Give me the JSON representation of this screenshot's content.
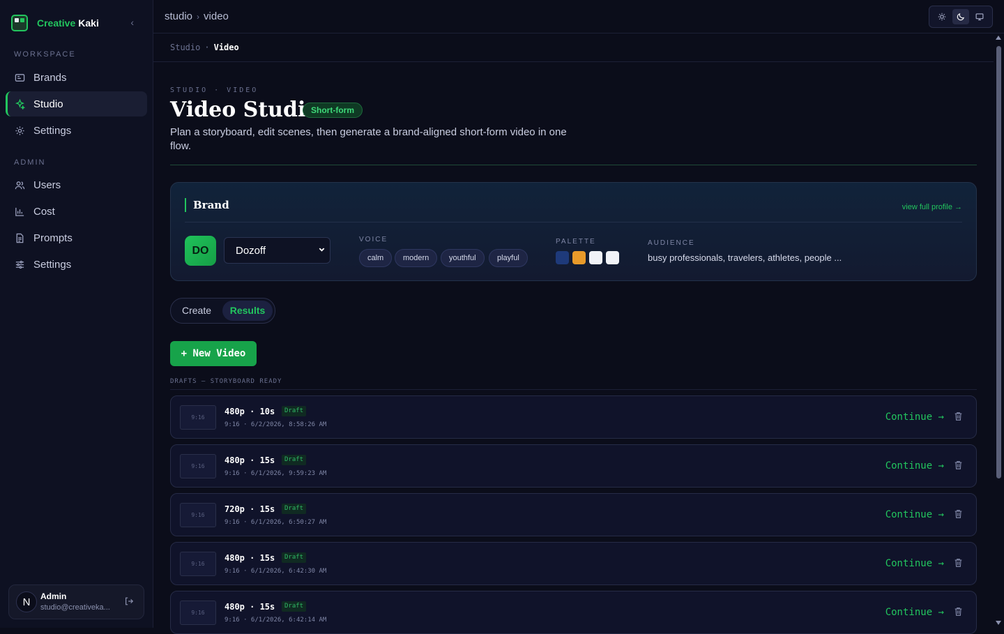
{
  "app": {
    "name_part1": "Creative",
    "name_part2": "Kaki"
  },
  "sidebar": {
    "workspace_label": "WORKSPACE",
    "workspace_items": [
      {
        "label": "Brands",
        "icon": "brands-icon"
      },
      {
        "label": "Studio",
        "icon": "sparkles-icon"
      },
      {
        "label": "Settings",
        "icon": "gear-icon"
      }
    ],
    "admin_label": "ADMIN",
    "admin_items": [
      {
        "label": "Users",
        "icon": "users-icon"
      },
      {
        "label": "Cost",
        "icon": "chart-icon"
      },
      {
        "label": "Prompts",
        "icon": "document-icon"
      },
      {
        "label": "Settings",
        "icon": "sliders-icon"
      }
    ],
    "active_item": "Studio"
  },
  "user": {
    "initial": "N",
    "name": "Admin",
    "email": "studio@creativeka..."
  },
  "topbar": {
    "crumb1": "studio",
    "crumb2": "video"
  },
  "subcrumbs": {
    "parent": "Studio",
    "current": "Video"
  },
  "page": {
    "eyebrow": "STUDIO · VIDEO",
    "title": "Video Studio",
    "badge": "Short-form",
    "subtitle": "Plan a storyboard, edit scenes, then generate a brand-aligned short-form video in one flow."
  },
  "brand": {
    "heading": "Brand",
    "view_profile": "view full profile →",
    "initials": "DO",
    "selected": "Dozoff",
    "voice_label": "VOICE",
    "voice": [
      "calm",
      "modern",
      "youthful",
      "playful"
    ],
    "palette_label": "PALETTE",
    "palette": [
      "#1e3a7a",
      "#e89a2a",
      "#f1f3f8",
      "#f1f3f8"
    ],
    "audience_label": "AUDIENCE",
    "audience": "busy professionals, travelers, athletes, people ..."
  },
  "tabs": {
    "create": "Create",
    "results": "Results",
    "active": "Results"
  },
  "actions": {
    "new_video": "+ New Video"
  },
  "drafts": {
    "label": "DRAFTS — STORYBOARD READY",
    "continue_label": "Continue →",
    "items": [
      {
        "thumb": "9:16",
        "title": "480p · 10s",
        "badge": "Draft",
        "meta": "9:16 · 6/2/2026, 8:58:26 AM"
      },
      {
        "thumb": "9:16",
        "title": "480p · 15s",
        "badge": "Draft",
        "meta": "9:16 · 6/1/2026, 9:59:23 AM"
      },
      {
        "thumb": "9:16",
        "title": "720p · 15s",
        "badge": "Draft",
        "meta": "9:16 · 6/1/2026, 6:50:27 AM"
      },
      {
        "thumb": "9:16",
        "title": "480p · 15s",
        "badge": "Draft",
        "meta": "9:16 · 6/1/2026, 6:42:30 AM"
      },
      {
        "thumb": "9:16",
        "title": "480p · 15s",
        "badge": "Draft",
        "meta": "9:16 · 6/1/2026, 6:42:14 AM"
      }
    ]
  },
  "colors": {
    "accent": "#22c55e",
    "background": "#0b0d1a"
  }
}
